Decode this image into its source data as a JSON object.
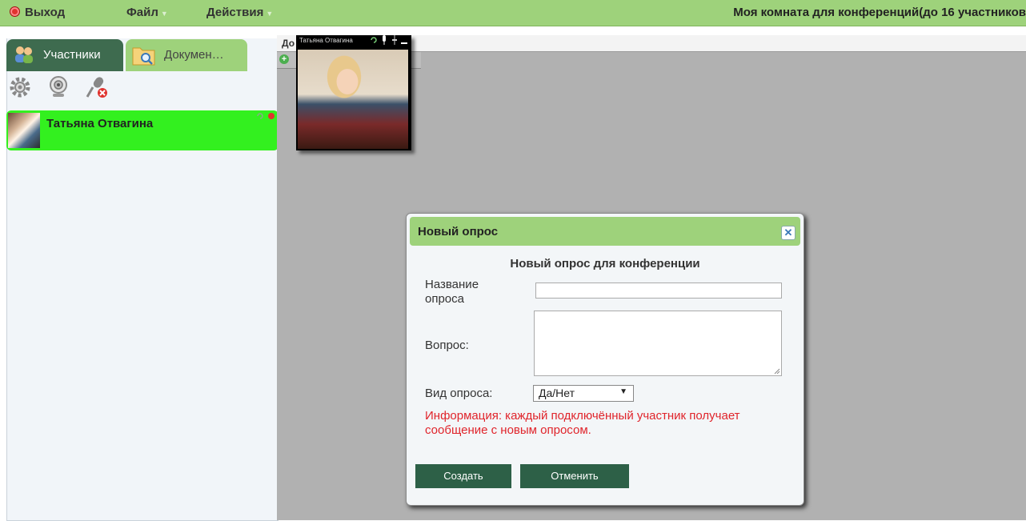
{
  "menu": {
    "exit_label": "Выход",
    "file_label": "Файл",
    "actions_label": "Действия",
    "room_title": "Моя комната для конференций(до 16 участников"
  },
  "sidebar": {
    "tabs": [
      {
        "label": "Участники",
        "icon": "participants-icon"
      },
      {
        "label": "Докумен…",
        "icon": "documents-folder-icon"
      }
    ],
    "tools": [
      "gear-icon",
      "webcam-icon",
      "microphone-muted-icon"
    ],
    "participant": {
      "name": "Татьяна Отвагина",
      "status_color": "#33f01f"
    }
  },
  "main": {
    "tab_label": "До",
    "video": {
      "title": "Татьяна Отвагина"
    }
  },
  "dialog": {
    "title": "Новый опрос",
    "heading": "Новый опрос для конференции",
    "name_label": "Название опроса",
    "name_value": "",
    "question_label": "Вопрос:",
    "question_value": "",
    "type_label": "Вид опроса:",
    "type_value": "Да/Нет",
    "info": "Информация: каждый подключённый участник получает сообщение с новым опросом.",
    "create_label": "Создать",
    "cancel_label": "Отменить"
  },
  "colors": {
    "topbar": "#9ed27b",
    "active_tab": "#3e6b4f",
    "participant_highlight": "#33f01f",
    "button": "#2d6047",
    "info_text": "#e0242b"
  }
}
